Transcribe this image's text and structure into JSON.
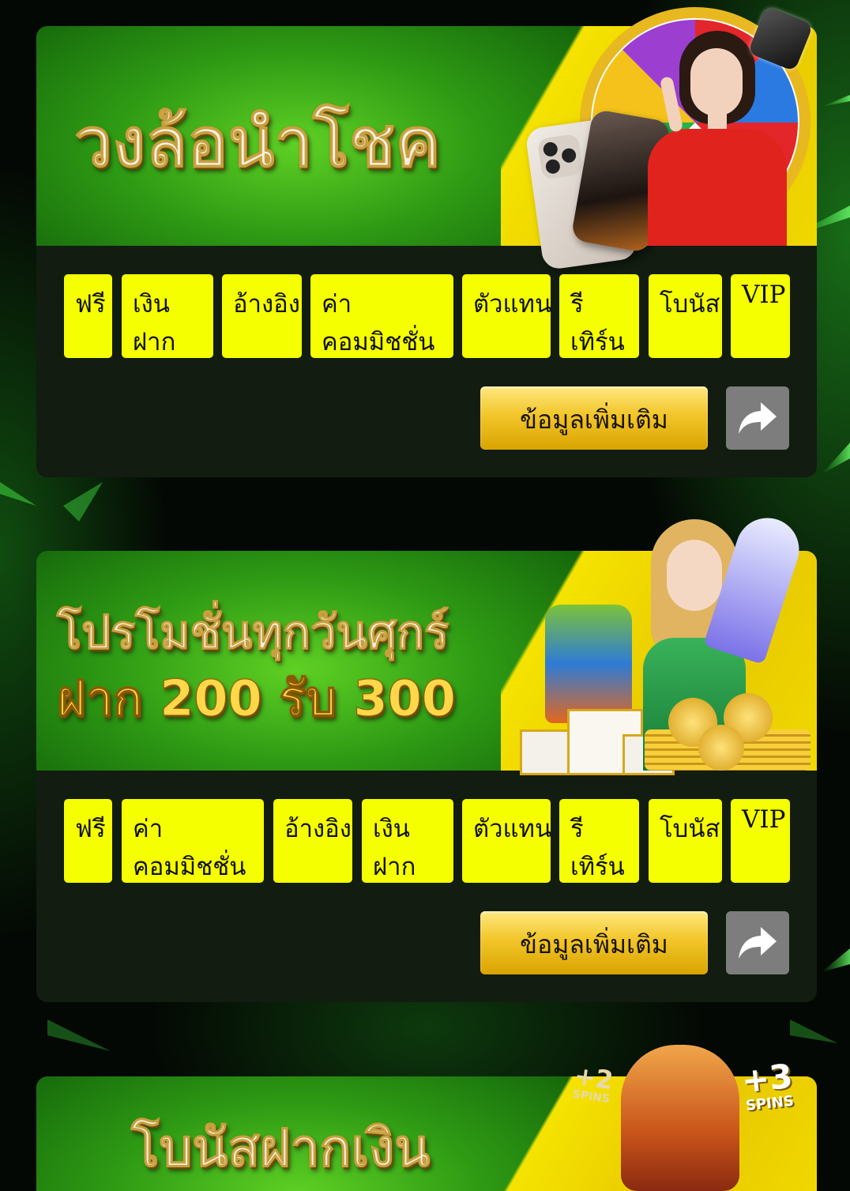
{
  "promotions": [
    {
      "banner_title": "วงล้อนำโชค",
      "tags": [
        "ฟรี",
        "เงิน\nฝาก",
        "อ้างอิง",
        "ค่า\nคอมมิชชั่น",
        "ตัวแทน",
        "รี\nเทิร์น",
        "โบนัส",
        "VIP"
      ],
      "more_label": "ข้อมูลเพิ่มเติม",
      "share_icon": "share-arrow-icon"
    },
    {
      "banner_title_line1": "โปรโมชั่นทุกวันศุกร์",
      "banner_title_line2": "ฝาก 200 รับ 300",
      "tags": [
        "ฟรี",
        "ค่า\nคอมมิชชั่น",
        "อ้างอิง",
        "เงิน\nฝาก",
        "ตัวแทน",
        "รี\nเทิร์น",
        "โบนัส",
        "VIP"
      ],
      "more_label": "ข้อมูลเพิ่มเติม",
      "share_icon": "share-arrow-icon"
    },
    {
      "banner_title": "โบนัสฝากเงิน",
      "badge_left": "+2",
      "badge_left_sub": "SPINS",
      "badge_right": "+3",
      "badge_right_sub": "SPINS"
    }
  ],
  "colors": {
    "tag_bg": "#f5ff00",
    "card_bg": "#121c10",
    "gold_button": "#f2c62a",
    "share_button": "#7d7d7d"
  }
}
